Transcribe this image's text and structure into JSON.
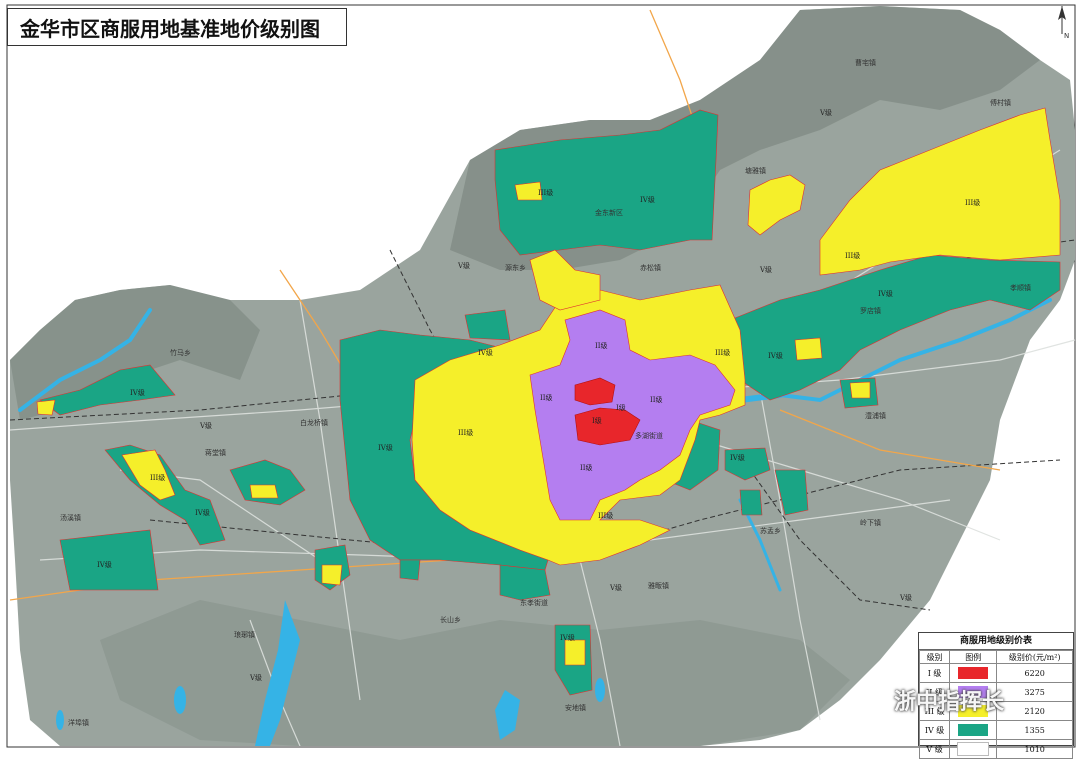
{
  "title": "金华市区商服用地基准地价级别图",
  "north_label": "N",
  "legend": {
    "title": "商服用地级别价表",
    "headers": [
      "级别",
      "图例",
      "级别价(元/m²)"
    ],
    "rows": [
      {
        "grade": "I 级",
        "color": "#e8262b",
        "price": "6220"
      },
      {
        "grade": "II 级",
        "color": "#b47ef0",
        "price": "3275"
      },
      {
        "grade": "III 级",
        "color": "#f5ef2a",
        "price": "2120"
      },
      {
        "grade": "IV 级",
        "color": "#1aa585",
        "price": "1355"
      },
      {
        "grade": "V 级",
        "color": "#ffffff",
        "price": "1010"
      }
    ]
  },
  "colors": {
    "background_land": "#9aa49e",
    "hills": "#7f8a83",
    "water": "#35b3e6",
    "roads": "#e0e3e1",
    "grade1": "#e8262b",
    "grade2": "#b47ef0",
    "grade3": "#f5ef2a",
    "grade4": "#1aa585"
  },
  "grade_labels": {
    "g1": "I级",
    "g2": "II级",
    "g3": "III级",
    "g4": "IV级",
    "g5": "V级"
  },
  "place_names": [
    "金东新区",
    "罗店镇",
    "澧浦镇",
    "孝顺镇",
    "曹宅镇",
    "傅村镇",
    "岭下镇",
    "汤溪镇",
    "白龙桥镇",
    "蒋堂镇",
    "雅畈镇",
    "安地镇",
    "苏孟乡",
    "赤松镇",
    "竹马乡",
    "长山乡",
    "琅琊镇",
    "洋埠镇",
    "源东乡",
    "塘雅镇",
    "多湖街道",
    "东孝街道"
  ],
  "watermark": "浙中指挥长"
}
